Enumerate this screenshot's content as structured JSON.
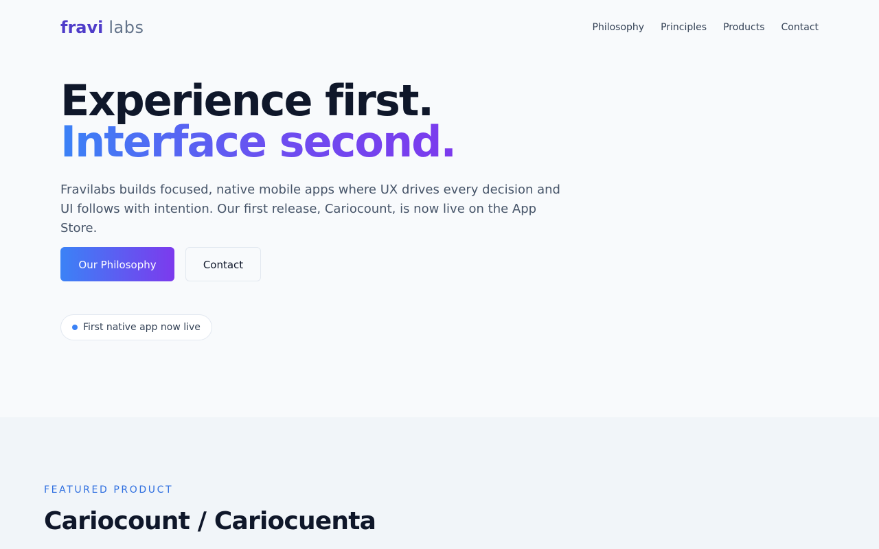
{
  "brand": {
    "primary": "fravi",
    "secondary": "labs"
  },
  "nav": {
    "items": [
      "Philosophy",
      "Principles",
      "Products",
      "Contact"
    ]
  },
  "hero": {
    "title_line1": "Experience first.",
    "title_line2": "Interface second.",
    "description": "Fravilabs builds focused, native mobile apps where UX drives every decision and UI follows with intention. Our first release, Cariocount, is now live on the App Store.",
    "primary_button": "Our Philosophy",
    "secondary_button": "Contact",
    "badge": "First native app now live"
  },
  "featured": {
    "eyebrow": "FEATURED PRODUCT",
    "title": "Cariocount / Cariocuenta"
  },
  "colors": {
    "brand_purple": "#4f3cc9",
    "gradient_start": "#3b82f6",
    "gradient_end": "#7c3aed",
    "text_dark": "#0f172a",
    "text_muted": "#475569",
    "accent_blue": "#2f6fe0"
  }
}
